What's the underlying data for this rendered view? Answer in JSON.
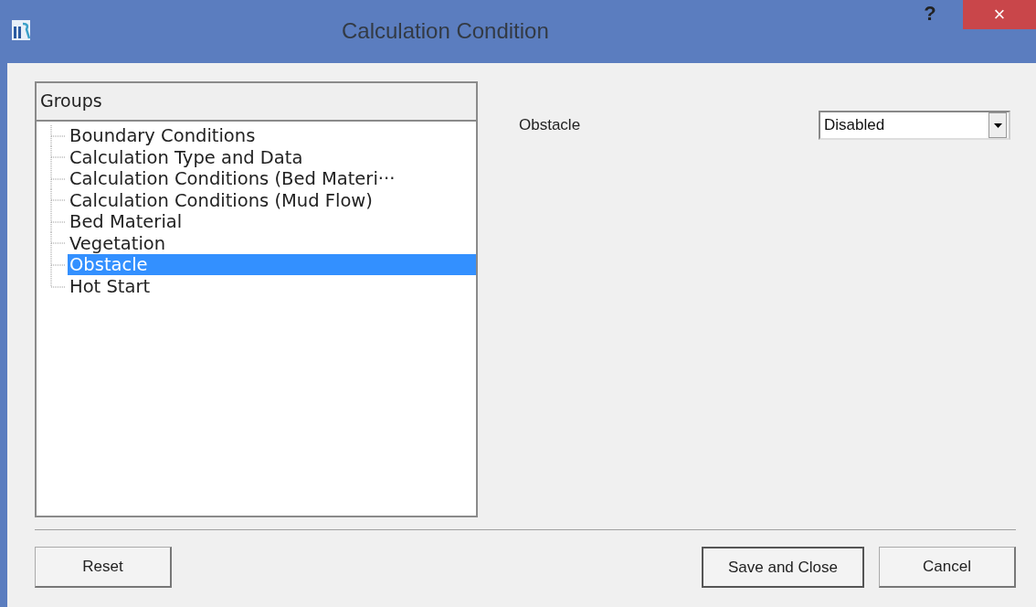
{
  "window": {
    "title": "Calculation Condition",
    "help": "?",
    "close": "×"
  },
  "groups": {
    "header": "Groups",
    "items": [
      {
        "label": "Boundary Conditions",
        "selected": false
      },
      {
        "label": "Calculation Type and Data",
        "selected": false
      },
      {
        "label": "Calculation Conditions (Bed Materi···",
        "selected": false
      },
      {
        "label": "Calculation Conditions (Mud Flow)",
        "selected": false
      },
      {
        "label": "Bed Material",
        "selected": false
      },
      {
        "label": "Vegetation",
        "selected": false
      },
      {
        "label": "Obstacle",
        "selected": true
      },
      {
        "label": "Hot Start",
        "selected": false
      }
    ]
  },
  "settings": [
    {
      "label": "Obstacle",
      "value": "Disabled"
    }
  ],
  "buttons": {
    "reset": "Reset",
    "save": "Save and Close",
    "cancel": "Cancel"
  }
}
